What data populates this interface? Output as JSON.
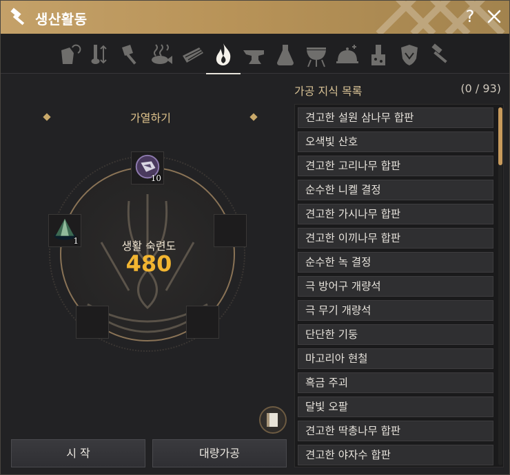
{
  "window": {
    "title": "생산활동",
    "help": "?"
  },
  "tabs": [
    {
      "icon": "gathering-icon",
      "active": false
    },
    {
      "icon": "alchemy-tools-icon",
      "active": false
    },
    {
      "icon": "axe-icon",
      "active": false
    },
    {
      "icon": "fish-icon",
      "active": false
    },
    {
      "icon": "grid-tool-icon",
      "active": false
    },
    {
      "icon": "flame-icon",
      "active": true
    },
    {
      "icon": "anvil-icon",
      "active": false
    },
    {
      "icon": "flask-icon",
      "active": false
    },
    {
      "icon": "grill-icon",
      "active": false
    },
    {
      "icon": "cloche-icon",
      "active": false
    },
    {
      "icon": "alchemy-station-icon",
      "active": false
    },
    {
      "icon": "shield-icon",
      "active": false
    },
    {
      "icon": "hammer-icon",
      "active": false
    }
  ],
  "recipe": {
    "title": "가열하기",
    "mastery_label": "생활 숙련도",
    "mastery_value": "480",
    "slots": [
      {
        "name": "top",
        "qty": "10",
        "item": "ore-item"
      },
      {
        "name": "left",
        "qty": "1",
        "item": "cone-item"
      },
      {
        "name": "right",
        "qty": "",
        "item": ""
      },
      {
        "name": "bottom-left",
        "qty": "",
        "item": ""
      },
      {
        "name": "bottom-right",
        "qty": "",
        "item": ""
      }
    ]
  },
  "buttons": {
    "start": "시 작",
    "mass": "대량가공"
  },
  "knowledge": {
    "label": "가공 지식 목록",
    "count": "(0 / 93)",
    "items": [
      "견고한 설원 삼나무 합판",
      "오색빛 산호",
      "견고한 고리나무 합판",
      "순수한 니켈 결정",
      "견고한 가시나무 합판",
      "견고한 이끼나무 합판",
      "순수한 녹 결정",
      "극 방어구 개량석",
      "극 무기 개량석",
      "단단한 기둥",
      "마고리아 현철",
      "흑금 주괴",
      "달빛 오팔",
      "견고한 딱총나무 합판",
      "견고한 야자수 합판"
    ]
  },
  "colors": {
    "accent": "#f2b531",
    "title_bar": "#c4a169",
    "scroll": "#c79a5c"
  }
}
